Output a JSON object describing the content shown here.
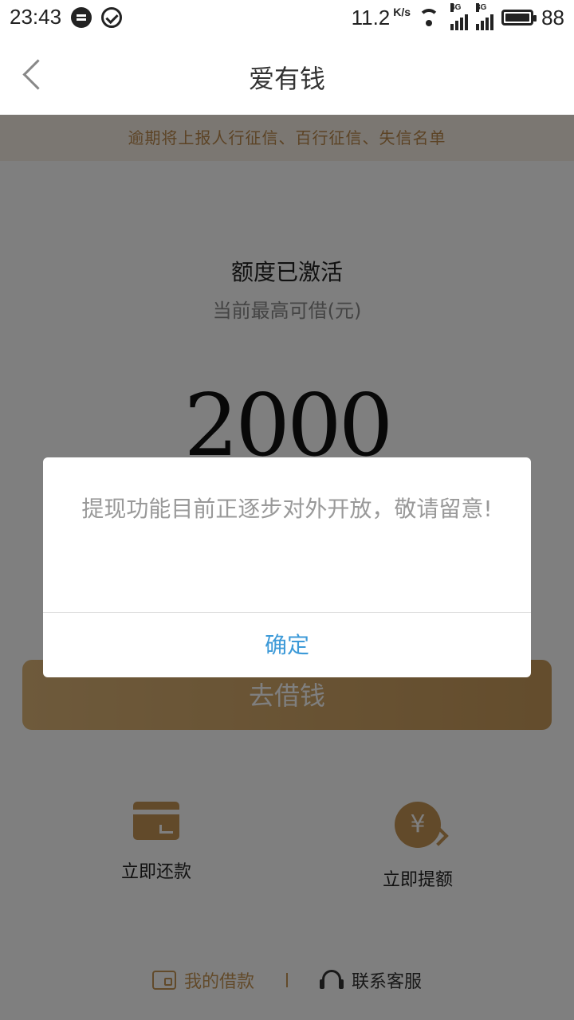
{
  "status_bar": {
    "time": "23:43",
    "net_speed": "11.2",
    "net_speed_unit": "K/s",
    "network1": "4G",
    "network2": "3G",
    "battery": "88"
  },
  "nav": {
    "title": "爱有钱"
  },
  "notice": "逾期将上报人行征信、百行征信、失信名单",
  "credit": {
    "status": "额度已激活",
    "subtitle": "当前最高可借(元)",
    "amount": "2000"
  },
  "borrow_button": "去借钱",
  "actions": {
    "repay_label": "立即还款",
    "raise_label": "立即提额",
    "raise_icon_symbol": "¥"
  },
  "footer": {
    "my_loans": "我的借款",
    "contact_service": "联系客服"
  },
  "dialog": {
    "message": "提现功能目前正逐步对外开放，敬请留意!",
    "confirm": "确定"
  },
  "colors": {
    "accent_gold": "#c59455",
    "link_blue": "#3d9ad8",
    "notice_bg": "#f7efe4"
  }
}
